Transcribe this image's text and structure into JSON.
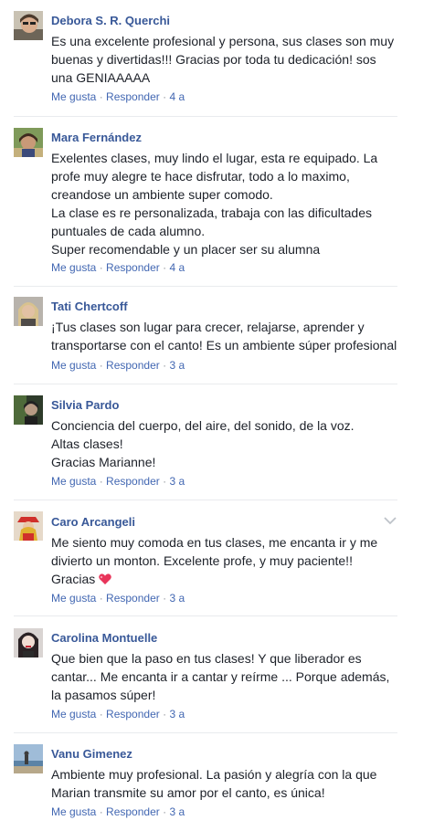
{
  "actions": {
    "like": "Me gusta",
    "dot": "·",
    "reply": "Responder"
  },
  "comments": [
    {
      "name": "Debora S. R. Querchi",
      "lines": [
        "Es una excelente profesional y persona, sus clases son muy",
        "buenas y divertidas!!! Gracias por toda tu dedicación! sos",
        "una GENIAAAAA"
      ],
      "time": "4 a",
      "avatar_icon": "profile-photo-woman-sunglasses"
    },
    {
      "name": "Mara Fernández",
      "lines": [
        "Exelentes clases, muy lindo el lugar, esta re equipado. La",
        "profe muy alegre te hace disfrutar, todo a lo maximo,",
        "creandose un ambiente super comodo.",
        "La clase es re personalizada, trabaja con las dificultades",
        "puntuales de cada alumno.",
        "Super recomendable y un placer ser su alumna"
      ],
      "time": "4 a",
      "avatar_icon": "profile-photo-woman-outdoors"
    },
    {
      "name": "Tati Chertcoff",
      "lines": [
        "¡Tus clases son lugar para crecer, relajarse, aprender y",
        "transportarse con el canto! Es un ambiente súper profesional"
      ],
      "time": "3 a",
      "avatar_icon": "profile-photo-blonde-woman"
    },
    {
      "name": "Silvia Pardo",
      "lines": [
        "Conciencia del cuerpo, del aire, del sonido, de la voz.",
        "Altas clases!",
        "Gracias Marianne!"
      ],
      "time": "3 a",
      "avatar_icon": "profile-photo-dark"
    },
    {
      "name": "Caro Arcangeli",
      "lines": [
        "Me siento muy comoda en tus clases, me encanta ir y me",
        "divierto un monton. Excelente profe, y muy paciente!!",
        "Gracias"
      ],
      "time": "3 a",
      "avatar_icon": "profile-photo-woman-red-hat",
      "heart_icon": "sparkling-heart-icon",
      "heart_color": "#e8345a"
    },
    {
      "name": "Carolina Montuelle",
      "lines": [
        "Que bien que la paso en tus clases! Y que liberador es",
        "cantar... Me encanta ir a cantar y reírme ... Porque además,",
        "la pasamos súper!"
      ],
      "time": "3 a",
      "avatar_icon": "profile-photo-woman-red-lips"
    },
    {
      "name": "Vanu Gimenez",
      "lines": [
        "Ambiente muy profesional. La pasión y alegría con la que",
        "Marian transmite su amor por el canto, es única!"
      ],
      "time": "3 a",
      "avatar_icon": "profile-photo-beach"
    }
  ],
  "colors": {
    "name": "#385898",
    "link": "#4267b2",
    "meta": "#90949c",
    "text": "#1d2129",
    "separator": "#e9ebee"
  }
}
